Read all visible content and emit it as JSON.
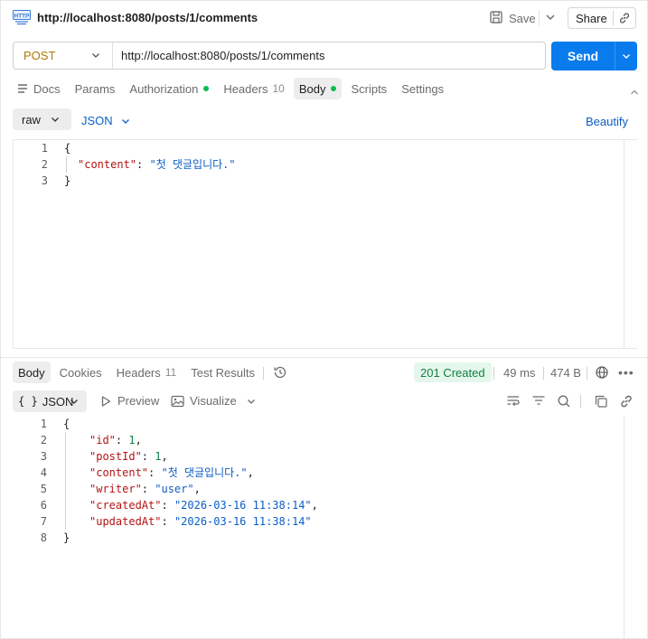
{
  "request": {
    "title": "http://localhost:8080/posts/1/comments",
    "icon": "http-icon",
    "save_label": "Save",
    "share_label": "Share",
    "method": "POST",
    "url": "http://localhost:8080/posts/1/comments",
    "send_label": "Send",
    "method_color": "#ad7a03",
    "send_color": "#097bed"
  },
  "req_tabs": [
    {
      "label": "Docs",
      "icon": "docs-icon"
    },
    {
      "label": "Params"
    },
    {
      "label": "Authorization",
      "dot": true
    },
    {
      "label": "Headers",
      "count": "10"
    },
    {
      "label": "Body",
      "dot": true,
      "active": true
    },
    {
      "label": "Scripts"
    },
    {
      "label": "Settings"
    }
  ],
  "body_options": {
    "mode": "raw",
    "language": "JSON",
    "beautify_label": "Beautify"
  },
  "request_body": {
    "lines": [
      "1",
      "2",
      "3"
    ],
    "open": "{",
    "key": "\"content\"",
    "colon": ": ",
    "value": "\"첫 댓글입니다.\"",
    "close": "}"
  },
  "res_tabs": [
    {
      "label": "Body",
      "active": true
    },
    {
      "label": "Cookies"
    },
    {
      "label": "Headers",
      "count": "11"
    },
    {
      "label": "Test Results"
    }
  ],
  "response_meta": {
    "status": "201 Created",
    "time": "49 ms",
    "size": "474 B",
    "status_color": "#0f8043"
  },
  "response_toolbar": {
    "braces": "{ }",
    "format": "JSON",
    "preview_label": "Preview",
    "visualize_label": "Visualize"
  },
  "response_body": {
    "line_numbers": [
      "1",
      "2",
      "3",
      "4",
      "5",
      "6",
      "7",
      "8"
    ],
    "open": "{",
    "fields": [
      {
        "key": "\"id\"",
        "value": "1",
        "type": "num",
        "comma": ","
      },
      {
        "key": "\"postId\"",
        "value": "1",
        "type": "num",
        "comma": ","
      },
      {
        "key": "\"content\"",
        "value": "\"첫 댓글입니다.\"",
        "type": "str",
        "comma": ","
      },
      {
        "key": "\"writer\"",
        "value": "\"user\"",
        "type": "str",
        "comma": ","
      },
      {
        "key": "\"createdAt\"",
        "value": "\"2026-03-16 11:38:14\"",
        "type": "str",
        "comma": ","
      },
      {
        "key": "\"updatedAt\"",
        "value": "\"2026-03-16 11:38:14\"",
        "type": "str",
        "comma": ""
      }
    ],
    "close": "}"
  }
}
